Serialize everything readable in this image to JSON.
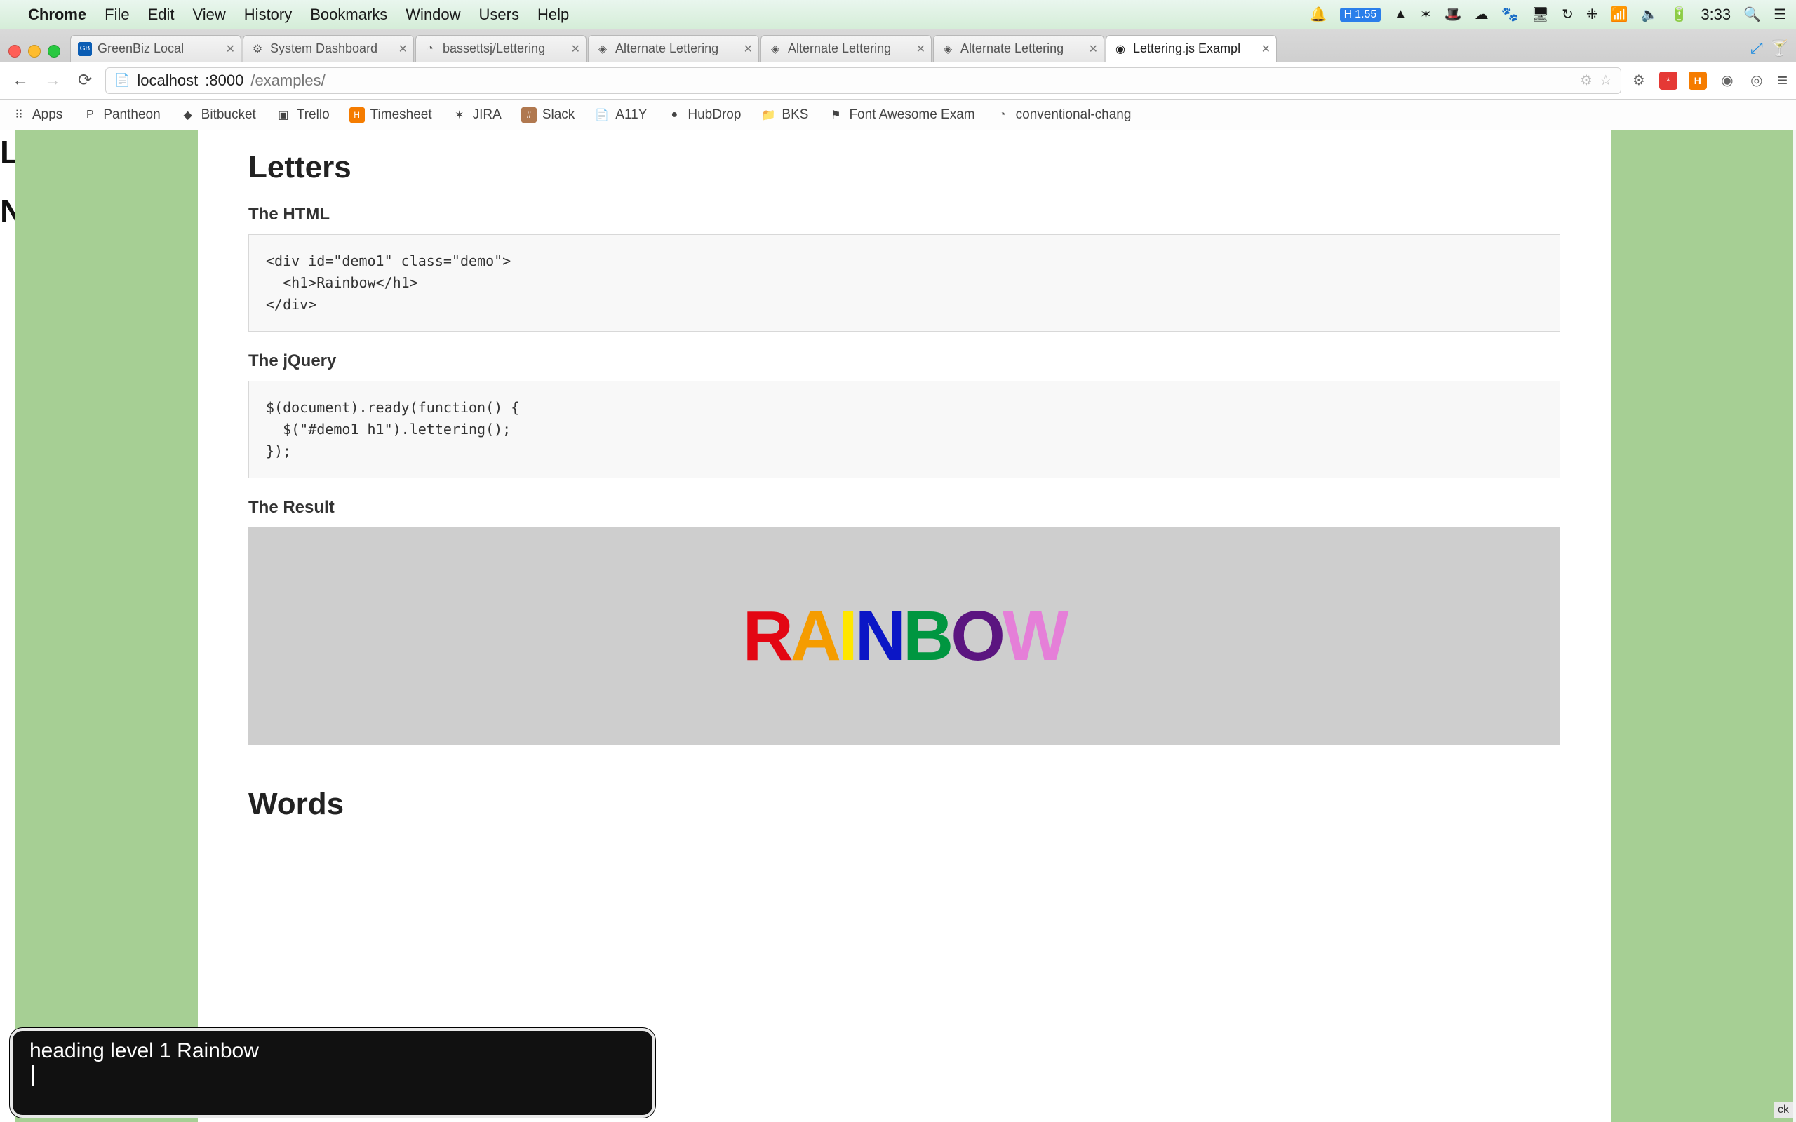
{
  "mac_menu": {
    "apple_glyph": "",
    "app_name": "Chrome",
    "items": [
      "File",
      "Edit",
      "View",
      "History",
      "Bookmarks",
      "Window",
      "Users",
      "Help"
    ],
    "battery_icon": "🔋",
    "clock": "3:33",
    "load_badge": "1.55",
    "load_prefix": "H"
  },
  "tabs": [
    {
      "label": "GreenBiz Local",
      "favicon": "GB"
    },
    {
      "label": "System Dashboard",
      "favicon": "⚙"
    },
    {
      "label": "bassettsj/Lettering",
      "favicon": "◔"
    },
    {
      "label": "Alternate Lettering",
      "favicon": "◈"
    },
    {
      "label": "Alternate Lettering",
      "favicon": "◈"
    },
    {
      "label": "Alternate Lettering",
      "favicon": "◈"
    },
    {
      "label": "Lettering.js Exampl",
      "favicon": "◉",
      "active": true
    }
  ],
  "address": {
    "host": "localhost",
    "port": ":8000",
    "path": "/examples/"
  },
  "bookmarks": [
    {
      "label": "Apps",
      "icon": "⠿"
    },
    {
      "label": "Pantheon",
      "icon": "P"
    },
    {
      "label": "Bitbucket",
      "icon": "◆"
    },
    {
      "label": "Trello",
      "icon": "▣"
    },
    {
      "label": "Timesheet",
      "icon": "H"
    },
    {
      "label": "JIRA",
      "icon": "✶"
    },
    {
      "label": "Slack",
      "icon": "#"
    },
    {
      "label": "A11Y",
      "icon": "📄"
    },
    {
      "label": "HubDrop",
      "icon": "●"
    },
    {
      "label": "BKS",
      "icon": "📁"
    },
    {
      "label": "Font Awesome Exam",
      "icon": "⚑"
    },
    {
      "label": "conventional-chang",
      "icon": "◔"
    }
  ],
  "page": {
    "section_title": "Letters",
    "sub_html": "The HTML",
    "code_html": "<div id=\"demo1\" class=\"demo\">\n  <h1>Rainbow</h1>\n</div>",
    "sub_jquery": "The jQuery",
    "code_jquery": "$(document).ready(function() {\n  $(\"#demo1 h1\").lettering();\n});",
    "sub_result": "The Result",
    "rainbow_letters": [
      {
        "char": "R",
        "color": "#e30613"
      },
      {
        "char": "A",
        "color": "#f59c00"
      },
      {
        "char": "I",
        "color": "#ffe600"
      },
      {
        "char": "N",
        "color": "#0b16c6"
      },
      {
        "char": "B",
        "color": "#009640"
      },
      {
        "char": "O",
        "color": "#5b1580"
      },
      {
        "char": "W",
        "color": "#e57fd8"
      }
    ],
    "next_section_title": "Words"
  },
  "left_sliver": {
    "line1": "L",
    "line2": "N"
  },
  "a11y": "heading level 1 Rainbow",
  "dock_peek": "ck"
}
